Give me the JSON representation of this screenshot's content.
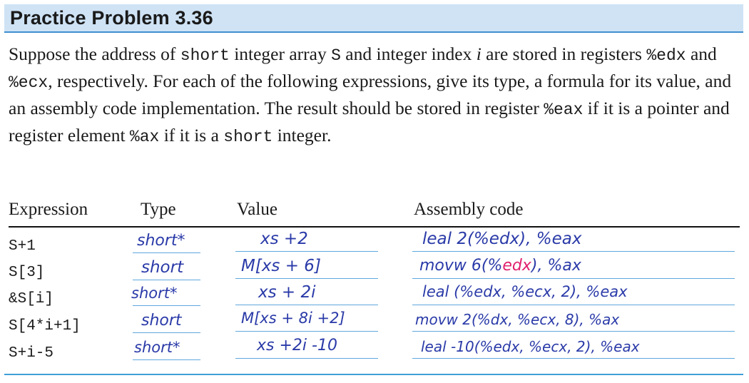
{
  "title": "Practice Problem 3.36",
  "paragraph": {
    "p1": "Suppose the address of ",
    "c1": "short",
    "p2": " integer array ",
    "c2": "S",
    "p3": " and integer index ",
    "i1": "i",
    "p4": " are stored in registers ",
    "c3": "%edx",
    "p5": " and ",
    "c4": "%ecx",
    "p6": ", respectively. For each of the following expressions, give its type, a formula for its value, and an assembly code implementation. The result should be stored in register ",
    "c5": "%eax",
    "p7": " if it is a pointer and register element ",
    "c6": "%ax",
    "p8": " if it is a ",
    "c7": "short",
    "p9": " integer."
  },
  "table": {
    "headers": {
      "expression": "Expression",
      "type": "Type",
      "value": "Value",
      "assembly": "Assembly code"
    },
    "rows": [
      {
        "expression": "S+1",
        "type": "short*",
        "value": "xs +2",
        "assembly": "leal 2(%edx), %eax"
      },
      {
        "expression": "S[3]",
        "type": "short",
        "value": "M[xs + 6]",
        "assembly_a": "movw 6(%",
        "assembly_b": "edx",
        "assembly_c": "), %ax"
      },
      {
        "expression": "&S[i]",
        "type": "short*",
        "value": "xs + 2i",
        "assembly": "leal (%edx, %ecx, 2), %eax"
      },
      {
        "expression": "S[4*i+1]",
        "type": "short",
        "value": "M[xs + 8i +2]",
        "assembly": "movw 2(%dx, %ecx, 8), %ax"
      },
      {
        "expression": "S+i-5",
        "type": "short*",
        "value": "xs +2i -10",
        "assembly": "leal -10(%edx, %ecx, 2), %eax"
      }
    ]
  },
  "colors": {
    "title_bg": "#cfe3f5",
    "title_rule": "#3f8fd0",
    "handwriting": "#2a3aa8",
    "handwriting_highlight": "#e0206e",
    "underline": "#5fa8dd"
  }
}
